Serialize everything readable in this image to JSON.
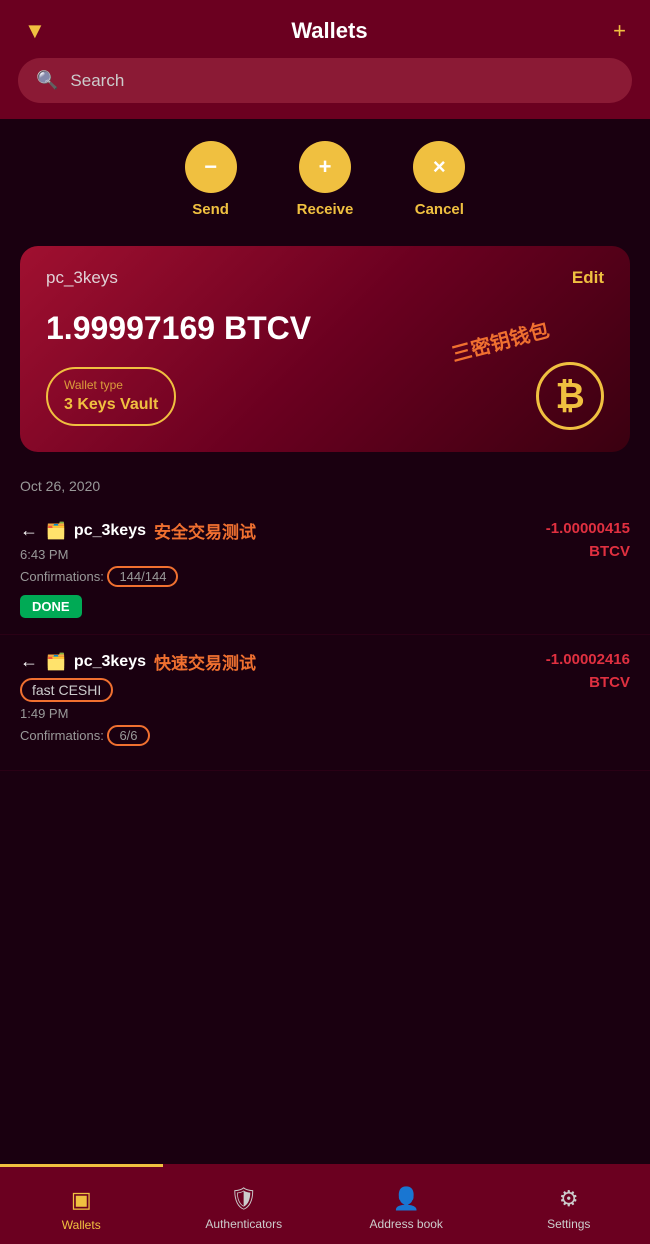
{
  "header": {
    "title": "Wallets",
    "filter_icon": "▼",
    "add_icon": "+"
  },
  "search": {
    "placeholder": "Search"
  },
  "actions": [
    {
      "id": "send",
      "icon": "−",
      "label": "Send"
    },
    {
      "id": "receive",
      "icon": "+",
      "label": "Receive"
    },
    {
      "id": "cancel",
      "icon": "×",
      "label": "Cancel"
    }
  ],
  "wallet_card": {
    "name": "pc_3keys",
    "edit_label": "Edit",
    "balance": "1.99997169 BTCV",
    "type_label": "Wallet type",
    "type_value": "3 Keys Vault",
    "annotation_chinese": "三密钥钱包",
    "bitcoin_symbol": "₿"
  },
  "date_label": "Oct 26, 2020",
  "transactions": [
    {
      "arrow": "←",
      "wallet_icon": "🗂",
      "wallet_name": "pc_3keys",
      "annotation_chinese": "安全交易测试",
      "time": "6:43 PM",
      "confirmations_label": "Confirmations:",
      "confirmations_value": "144/144",
      "status": "DONE",
      "amount": "-1.00000415",
      "currency": "BTCV"
    },
    {
      "arrow": "←",
      "wallet_icon": "🗂",
      "wallet_name": "pc_3keys",
      "annotation_chinese": "快速交易测试",
      "subname": "fast CESHI",
      "time": "1:49 PM",
      "confirmations_label": "Confirmations:",
      "confirmations_value": "6/6",
      "status": "",
      "amount": "-1.00002416",
      "currency": "BTCV"
    }
  ],
  "bottom_nav": [
    {
      "id": "wallets",
      "icon": "▣",
      "label": "Wallets",
      "active": true
    },
    {
      "id": "authenticators",
      "icon": "🛡",
      "label": "Authenticators",
      "active": false
    },
    {
      "id": "address-book",
      "icon": "👤",
      "label": "Address book",
      "active": false
    },
    {
      "id": "settings",
      "icon": "⚙",
      "label": "Settings",
      "active": false
    }
  ]
}
